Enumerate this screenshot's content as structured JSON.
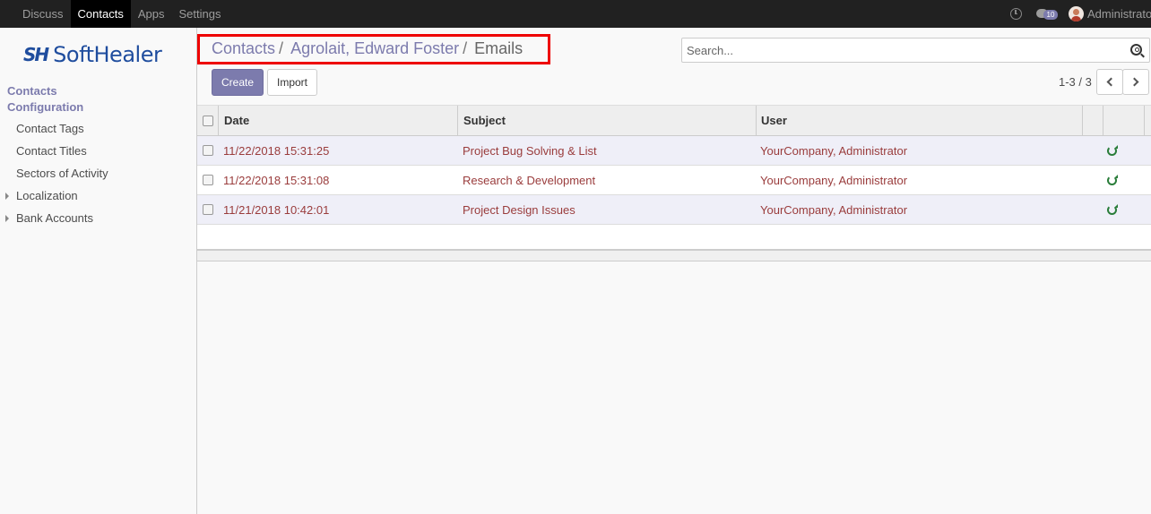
{
  "topbar": {
    "menu": [
      {
        "label": "Discuss",
        "active": false
      },
      {
        "label": "Contacts",
        "active": true
      },
      {
        "label": "Apps",
        "active": false
      },
      {
        "label": "Settings",
        "active": false
      }
    ],
    "messages_badge": "10",
    "user": "Administrator"
  },
  "sidebar": {
    "logo_mark": "SH",
    "logo_text": "SoftHealer",
    "sections": [
      "Contacts",
      "Configuration"
    ],
    "items": [
      "Contact Tags",
      "Contact Titles",
      "Sectors of Activity"
    ],
    "expandable": [
      "Localization",
      "Bank Accounts"
    ]
  },
  "breadcrumb": {
    "items": [
      "Contacts",
      "Agrolait, Edward Foster",
      "Emails"
    ],
    "separator": "/"
  },
  "search": {
    "placeholder": "Search..."
  },
  "buttons": {
    "create": "Create",
    "import": "Import"
  },
  "pager": {
    "value": "1-3 / 3"
  },
  "list": {
    "columns": [
      "Date",
      "Subject",
      "User"
    ],
    "rows": [
      {
        "date": "11/22/2018 15:31:25",
        "subject": "Project Bug Solving & List",
        "user": "YourCompany, Administrator"
      },
      {
        "date": "11/22/2018 15:31:08",
        "subject": "Research & Development",
        "user": "YourCompany, Administrator"
      },
      {
        "date": "11/21/2018 10:42:01",
        "subject": "Project Design Issues",
        "user": "YourCompany, Administrator"
      }
    ]
  },
  "colors": {
    "accent": "#7c7bad",
    "data_text": "#9a3c3c",
    "highlight_box": "#e00000",
    "refresh": "#2a7d3a"
  }
}
